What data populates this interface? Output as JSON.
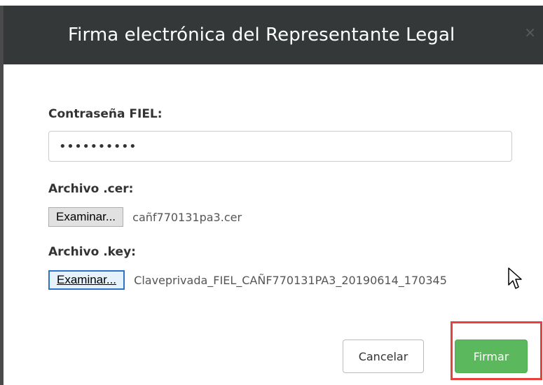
{
  "dialog": {
    "title": "Firma electrónica del Representante Legal",
    "close_symbol": "×"
  },
  "form": {
    "password_label": "Contraseña FIEL:",
    "password_value": "••••••••••",
    "cer_label": "Archivo .cer:",
    "cer_button": "Examinar...",
    "cer_file": "cañf770131pa3.cer",
    "key_label": "Archivo .key:",
    "key_button": "Examinar...",
    "key_file": "Claveprivada_FIEL_CAÑF770131PA3_20190614_170345"
  },
  "footer": {
    "cancel_label": "Cancelar",
    "sign_label": "Firmar"
  },
  "colors": {
    "header_bg": "#353839",
    "sign_button": "#5cb85c",
    "highlight": "#e8413c",
    "focus_border": "#2a73c9"
  },
  "icons": {
    "close": "close-icon",
    "cursor": "mouse-pointer-icon"
  }
}
